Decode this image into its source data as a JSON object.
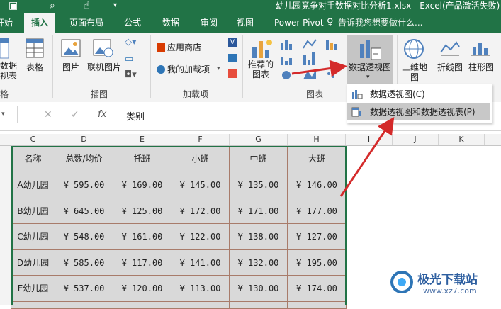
{
  "window": {
    "title": "幼儿园竞争对手数据对比分析1.xlsx - Excel(产品激活失败)"
  },
  "tabs": [
    {
      "label": "开始"
    },
    {
      "label": "插入"
    },
    {
      "label": "页面布局"
    },
    {
      "label": "公式"
    },
    {
      "label": "数据"
    },
    {
      "label": "审阅"
    },
    {
      "label": "视图"
    },
    {
      "label": "Power Pivot"
    }
  ],
  "tell_me": "告诉我您想要做什么...",
  "ribbon": {
    "pivot_label_1": "数据",
    "pivot_label_2": "视表",
    "table_label": "表格",
    "picture_label": "图片",
    "online_picture_label": "联机图片",
    "illustrations_group": "插图",
    "app_store_label": "应用商店",
    "my_addins_label": "我的加载项",
    "addins_group": "加载项",
    "recommended_label_1": "推荐的",
    "recommended_label_2": "图表",
    "charts_group": "图表",
    "pivotchart_label": "数据透视图",
    "map3d_label_1": "三维地",
    "map3d_label_2": "图",
    "line_label": "折线图",
    "column_label": "柱形图",
    "left_group_fragment": "格"
  },
  "dropdown": {
    "items": [
      {
        "label": "数据透视图(C)"
      },
      {
        "label": "数据透视图和数据透视表(P)"
      }
    ]
  },
  "formula_bar": {
    "fx": "fx",
    "value": "类别"
  },
  "columns": [
    "C",
    "D",
    "E",
    "F",
    "G",
    "H",
    "I",
    "J",
    "K"
  ],
  "table": {
    "headers": [
      "名称",
      "总数/均价",
      "托班",
      "小班",
      "中班",
      "大班"
    ],
    "rows": [
      [
        "A幼儿园",
        "¥ 595.00",
        "¥ 169.00",
        "¥ 145.00",
        "¥ 135.00",
        "¥ 146.00"
      ],
      [
        "B幼儿园",
        "¥ 645.00",
        "¥ 125.00",
        "¥ 172.00",
        "¥ 171.00",
        "¥ 177.00"
      ],
      [
        "C幼儿园",
        "¥ 548.00",
        "¥ 161.00",
        "¥ 122.00",
        "¥ 138.00",
        "¥ 127.00"
      ],
      [
        "D幼儿园",
        "¥ 585.00",
        "¥ 117.00",
        "¥ 141.00",
        "¥ 132.00",
        "¥ 195.00"
      ],
      [
        "E幼儿园",
        "¥ 537.00",
        "¥ 120.00",
        "¥ 113.00",
        "¥ 130.00",
        "¥ 174.00"
      ]
    ]
  },
  "watermark": {
    "name": "极光下载站",
    "url": "www.xz7.com"
  },
  "colors": {
    "excel_green": "#217346",
    "cell_fill": "#d9d9d9",
    "cell_border": "#a87b6a",
    "arrow_red": "#d42a2a"
  }
}
